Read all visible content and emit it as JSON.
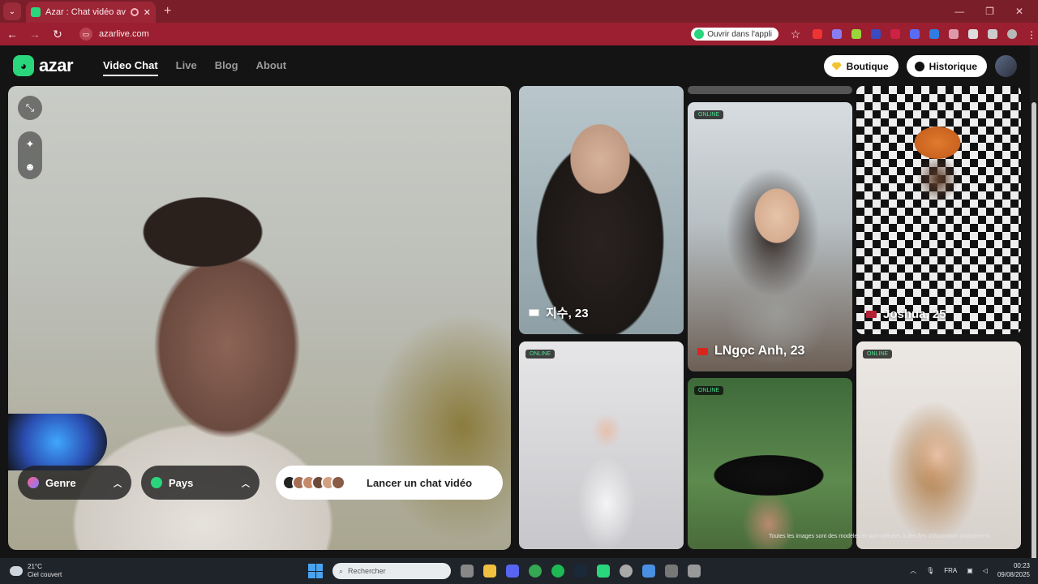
{
  "browser": {
    "tab_title": "Azar : Chat vidéo avec de n",
    "tab_close": "✕",
    "new_tab": "+",
    "url": "azarlive.com",
    "open_in_app": "Ouvrir dans l'appli",
    "window_controls": [
      "—",
      "❐",
      "✕"
    ]
  },
  "header": {
    "logo_text": "azar",
    "nav": [
      "Video Chat",
      "Live",
      "Blog",
      "About"
    ],
    "active_nav": "Video Chat",
    "boutique_label": "Boutique",
    "historique_label": "Historique"
  },
  "video": {
    "genre_label": "Genre",
    "pays_label": "Pays",
    "launch_label": "Lancer un chat vidéo"
  },
  "gallery": {
    "online_badge": "ONLINE",
    "cards": [
      {
        "name": "지수, 23",
        "flag_colors": [
          "#ffffff",
          "#c8102e"
        ],
        "online": false
      },
      {
        "name": "LNgọc Anh, 23",
        "flag_colors": [
          "#da251d",
          "#ffcd00"
        ],
        "online": true
      },
      {
        "name": "Joshua, 25",
        "flag_colors": [
          "#b22234",
          "#3c3b6e"
        ],
        "online": false
      },
      {
        "name": "",
        "online": true
      },
      {
        "name": "",
        "online": true
      },
      {
        "name": "",
        "online": true
      }
    ],
    "disclaimer": "Toutes les images sont des modèles et sont utilisées à des fins d'illustration uniquement."
  },
  "taskbar": {
    "temperature": "21°C",
    "weather": "Ciel couvert",
    "search_placeholder": "Rechercher",
    "language": "FRA",
    "time": "00:23",
    "date": "09/08/2025"
  },
  "colors": {
    "brand": "#2ad67c",
    "tabbar": "#7a1e2a",
    "addressbar": "#9b1f30"
  }
}
